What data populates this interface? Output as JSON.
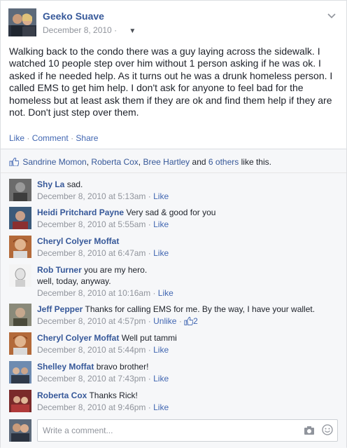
{
  "post": {
    "author": "Geeko Suave",
    "date": "December 8, 2010",
    "date_sep": "·",
    "text": "Walking back to the condo there was a guy laying across the sidewalk. I watched 10 people step over him without 1 person asking if he was ok. I asked if he needed help. As it turns out he was a drunk homeless person. I called EMS to get him help. I don't ask for anyone to feel bad for the homeless but at least ask them if they are ok and find them help if they are not. Don't just step over them.",
    "actions": {
      "like": "Like",
      "comment": "Comment",
      "share": "Share",
      "sep": "·"
    }
  },
  "likes": {
    "names": [
      "Sandrine Momon",
      "Roberta Cox",
      "Bree Hartley"
    ],
    "comma": ",",
    "and": "and",
    "others": "6 others",
    "suffix": "like this."
  },
  "comments": [
    {
      "name": "Shy La",
      "text": "sad.",
      "time": "December 8, 2010 at 5:13am",
      "action": "Like"
    },
    {
      "name": "Heidi Pritchard Payne",
      "text": "Very sad & good for you",
      "time": "December 8, 2010 at 5:55am",
      "action": "Like"
    },
    {
      "name": "Cheryl Colyer Moffat",
      "text": "",
      "time": "December 8, 2010 at 6:47am",
      "action": "Like"
    },
    {
      "name": "Rob Turner",
      "text": "you are my hero.",
      "text2": "well, today, anyway.",
      "time": "December 8, 2010 at 10:16am",
      "action": "Like"
    },
    {
      "name": "Jeff Pepper",
      "text": "Thanks for calling EMS for me. By the way, I have your wallet.",
      "time": "December 8, 2010 at 4:57pm",
      "action": "Unlike",
      "likes": "2"
    },
    {
      "name": "Cheryl Colyer Moffat",
      "text": "Well put tammi",
      "time": "December 8, 2010 at 5:44pm",
      "action": "Like"
    },
    {
      "name": "Shelley Moffat",
      "text": "bravo brother!",
      "time": "December 8, 2010 at 7:43pm",
      "action": "Like"
    },
    {
      "name": "Roberta Cox",
      "text": "Thanks Rick!",
      "time": "December 8, 2010 at 9:46pm",
      "action": "Like"
    }
  ],
  "meta_sep": "·",
  "compose": {
    "placeholder": "Write a comment..."
  },
  "colors": {
    "link": "#365899",
    "action": "#4267b2",
    "muted": "#90949c"
  },
  "icons": [
    "chevron-down-icon",
    "caret-down-icon",
    "thumbs-up-icon",
    "camera-icon",
    "smiley-icon"
  ]
}
